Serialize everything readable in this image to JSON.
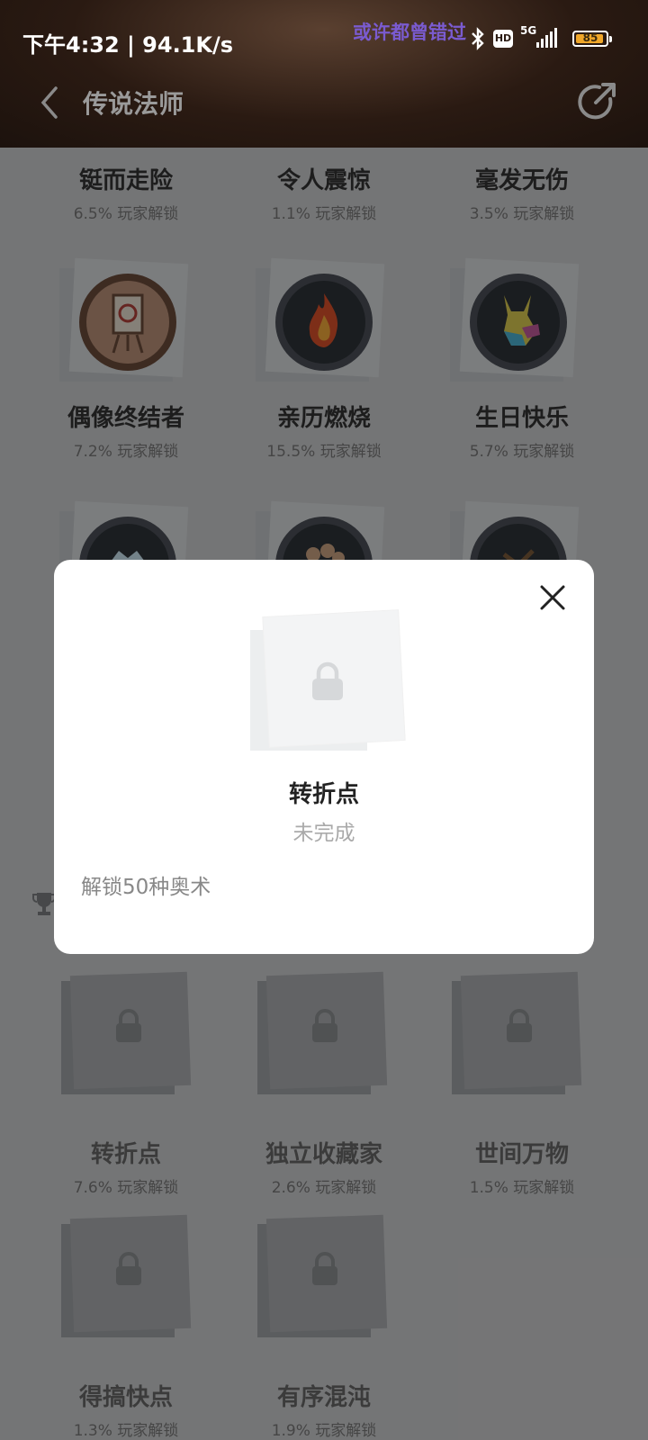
{
  "status_bar": {
    "time": "下午4:32 | 94.1K/s",
    "lyric": "或许都曾错过",
    "hd_label": "HD",
    "network": "5G",
    "battery": "85"
  },
  "nav": {
    "title": "传说法师"
  },
  "achievements": [
    {
      "name": "铤而走险",
      "rate": "6.5% 玩家解锁"
    },
    {
      "name": "令人震惊",
      "rate": "1.1% 玩家解锁"
    },
    {
      "name": "毫发无伤",
      "rate": "3.5% 玩家解锁"
    },
    {
      "name": "偶像终结者",
      "rate": "7.2% 玩家解锁"
    },
    {
      "name": "亲历燃烧",
      "rate": "15.5% 玩家解锁"
    },
    {
      "name": "生日快乐",
      "rate": "5.7% 玩家解锁"
    },
    {
      "name": "转折点",
      "rate": "7.6% 玩家解锁"
    },
    {
      "name": "独立收藏家",
      "rate": "2.6% 玩家解锁"
    },
    {
      "name": "世间万物",
      "rate": "1.5% 玩家解锁"
    },
    {
      "name": "得搞快点",
      "rate": "1.3% 玩家解锁"
    },
    {
      "name": "有序混沌",
      "rate": "1.9% 玩家解锁"
    }
  ],
  "modal": {
    "name": "转折点",
    "status": "未完成",
    "description": "解锁50种奥术"
  },
  "icons": {
    "back": "chevron-left-icon",
    "share": "share-icon",
    "close": "close-icon",
    "lock": "lock-icon",
    "trophy": "trophy-icon"
  }
}
